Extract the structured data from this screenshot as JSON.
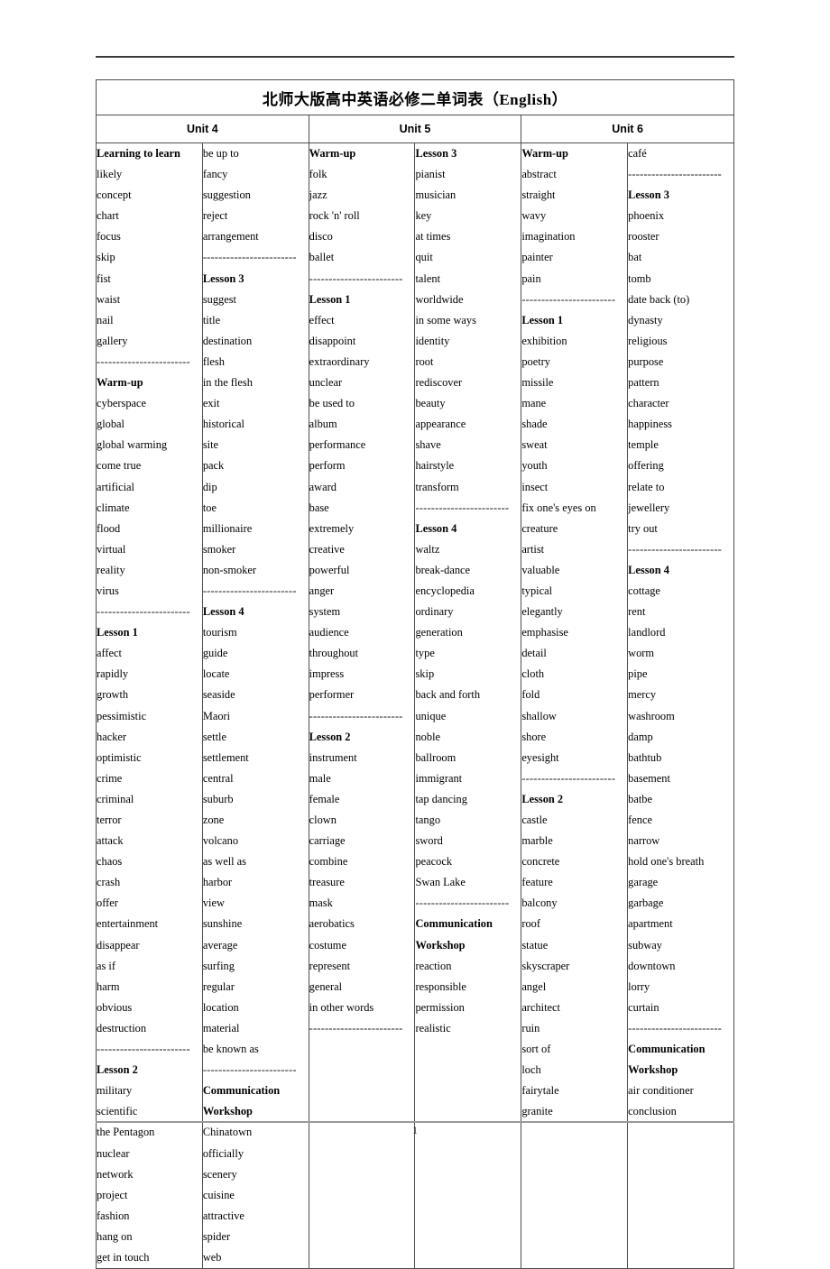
{
  "document": {
    "title": "北师大版高中英语必修二单词表（English）",
    "page_number": "1"
  },
  "units": [
    {
      "label": "Unit 4"
    },
    {
      "label": "Unit 5"
    },
    {
      "label": "Unit 6"
    }
  ],
  "separator": "------------------------",
  "columns": [
    {
      "id": "unit4-col1",
      "items": [
        {
          "text": "Learning to learn",
          "bold": true
        },
        {
          "text": "likely"
        },
        {
          "text": "concept"
        },
        {
          "text": "chart"
        },
        {
          "text": "focus"
        },
        {
          "text": "skip"
        },
        {
          "text": "fist"
        },
        {
          "text": "waist"
        },
        {
          "text": "nail"
        },
        {
          "text": "gallery"
        },
        {
          "text": "------------------------",
          "sep": true
        },
        {
          "text": "Warm-up",
          "bold": true
        },
        {
          "text": "cyberspace"
        },
        {
          "text": "global"
        },
        {
          "text": "global warming"
        },
        {
          "text": "come true"
        },
        {
          "text": "artificial"
        },
        {
          "text": "climate"
        },
        {
          "text": "flood"
        },
        {
          "text": "virtual"
        },
        {
          "text": "reality"
        },
        {
          "text": "virus"
        },
        {
          "text": "------------------------",
          "sep": true
        },
        {
          "text": "Lesson 1",
          "bold": true
        },
        {
          "text": "affect"
        },
        {
          "text": "rapidly"
        },
        {
          "text": "growth"
        },
        {
          "text": "pessimistic"
        },
        {
          "text": "hacker"
        },
        {
          "text": "optimistic"
        },
        {
          "text": "crime"
        },
        {
          "text": "criminal"
        },
        {
          "text": "terror"
        },
        {
          "text": "attack"
        },
        {
          "text": "chaos"
        },
        {
          "text": "crash"
        },
        {
          "text": "offer"
        },
        {
          "text": "entertainment"
        },
        {
          "text": "disappear"
        },
        {
          "text": "as if"
        },
        {
          "text": "harm"
        },
        {
          "text": "obvious"
        },
        {
          "text": "destruction"
        },
        {
          "text": "------------------------",
          "sep": true
        },
        {
          "text": "Lesson 2",
          "bold": true
        },
        {
          "text": "military"
        },
        {
          "text": "scientific"
        },
        {
          "text": "the Pentagon"
        },
        {
          "text": "nuclear"
        },
        {
          "text": "network"
        },
        {
          "text": "project"
        },
        {
          "text": "fashion"
        },
        {
          "text": "hang on"
        },
        {
          "text": "get in touch"
        }
      ]
    },
    {
      "id": "unit4-col2",
      "items": [
        {
          "text": "be up to"
        },
        {
          "text": "fancy"
        },
        {
          "text": "suggestion"
        },
        {
          "text": "reject"
        },
        {
          "text": "arrangement"
        },
        {
          "text": "------------------------",
          "sep": true
        },
        {
          "text": "Lesson 3",
          "bold": true
        },
        {
          "text": "suggest"
        },
        {
          "text": "title"
        },
        {
          "text": "destination"
        },
        {
          "text": "flesh"
        },
        {
          "text": "in the flesh"
        },
        {
          "text": "exit"
        },
        {
          "text": "historical"
        },
        {
          "text": "site"
        },
        {
          "text": "pack"
        },
        {
          "text": "dip"
        },
        {
          "text": "toe"
        },
        {
          "text": "millionaire"
        },
        {
          "text": "smoker"
        },
        {
          "text": "non-smoker"
        },
        {
          "text": "------------------------",
          "sep": true
        },
        {
          "text": "Lesson 4",
          "bold": true
        },
        {
          "text": "tourism"
        },
        {
          "text": "guide"
        },
        {
          "text": "locate"
        },
        {
          "text": "seaside"
        },
        {
          "text": "Maori"
        },
        {
          "text": "settle"
        },
        {
          "text": "settlement"
        },
        {
          "text": "central"
        },
        {
          "text": "suburb"
        },
        {
          "text": "zone"
        },
        {
          "text": "volcano"
        },
        {
          "text": "as well as"
        },
        {
          "text": "harbor"
        },
        {
          "text": "view"
        },
        {
          "text": "sunshine"
        },
        {
          "text": "average"
        },
        {
          "text": "surfing"
        },
        {
          "text": "regular"
        },
        {
          "text": "location"
        },
        {
          "text": "material"
        },
        {
          "text": "be known as"
        },
        {
          "text": "------------------------",
          "sep": true
        },
        {
          "text": "Communication",
          "bold": true
        },
        {
          "text": "Workshop",
          "bold": true
        },
        {
          "text": "Chinatown"
        },
        {
          "text": "officially"
        },
        {
          "text": "scenery"
        },
        {
          "text": "cuisine"
        },
        {
          "text": "attractive"
        },
        {
          "text": "spider"
        },
        {
          "text": "web"
        }
      ]
    },
    {
      "id": "unit5-col1",
      "items": [
        {
          "text": "Warm-up",
          "bold": true
        },
        {
          "text": "folk"
        },
        {
          "text": "jazz"
        },
        {
          "text": "rock 'n' roll"
        },
        {
          "text": "disco"
        },
        {
          "text": "ballet"
        },
        {
          "text": "------------------------",
          "sep": true
        },
        {
          "text": "Lesson 1",
          "bold": true
        },
        {
          "text": "effect"
        },
        {
          "text": "disappoint"
        },
        {
          "text": "extraordinary"
        },
        {
          "text": "unclear"
        },
        {
          "text": "be used to"
        },
        {
          "text": "album"
        },
        {
          "text": "performance"
        },
        {
          "text": "perform"
        },
        {
          "text": "award"
        },
        {
          "text": "base"
        },
        {
          "text": "extremely"
        },
        {
          "text": "creative"
        },
        {
          "text": "powerful"
        },
        {
          "text": "anger"
        },
        {
          "text": "system"
        },
        {
          "text": "audience"
        },
        {
          "text": "throughout"
        },
        {
          "text": "impress"
        },
        {
          "text": "performer"
        },
        {
          "text": "------------------------",
          "sep": true
        },
        {
          "text": "Lesson 2",
          "bold": true
        },
        {
          "text": "instrument"
        },
        {
          "text": "male"
        },
        {
          "text": "female"
        },
        {
          "text": "clown"
        },
        {
          "text": "carriage"
        },
        {
          "text": "combine"
        },
        {
          "text": "treasure"
        },
        {
          "text": "mask"
        },
        {
          "text": "aerobatics"
        },
        {
          "text": "costume"
        },
        {
          "text": "represent"
        },
        {
          "text": "general"
        },
        {
          "text": "in other words"
        },
        {
          "text": "------------------------",
          "sep": true
        }
      ]
    },
    {
      "id": "unit5-col2",
      "items": [
        {
          "text": "Lesson 3",
          "bold": true
        },
        {
          "text": "pianist"
        },
        {
          "text": "musician"
        },
        {
          "text": "key"
        },
        {
          "text": "at times"
        },
        {
          "text": "quit"
        },
        {
          "text": "talent"
        },
        {
          "text": "worldwide"
        },
        {
          "text": "in some ways"
        },
        {
          "text": "identity"
        },
        {
          "text": "root"
        },
        {
          "text": "rediscover"
        },
        {
          "text": "beauty"
        },
        {
          "text": "appearance"
        },
        {
          "text": "shave"
        },
        {
          "text": "hairstyle"
        },
        {
          "text": "transform"
        },
        {
          "text": "------------------------",
          "sep": true
        },
        {
          "text": "Lesson 4",
          "bold": true
        },
        {
          "text": "waltz"
        },
        {
          "text": "break-dance"
        },
        {
          "text": "encyclopedia"
        },
        {
          "text": "ordinary"
        },
        {
          "text": "generation"
        },
        {
          "text": "type"
        },
        {
          "text": "skip"
        },
        {
          "text": "back and forth"
        },
        {
          "text": "unique"
        },
        {
          "text": "noble"
        },
        {
          "text": "ballroom"
        },
        {
          "text": "immigrant"
        },
        {
          "text": "tap dancing"
        },
        {
          "text": "tango"
        },
        {
          "text": "sword"
        },
        {
          "text": "peacock"
        },
        {
          "text": "Swan Lake"
        },
        {
          "text": "------------------------",
          "sep": true
        },
        {
          "text": "Communication",
          "bold": true
        },
        {
          "text": "Workshop",
          "bold": true
        },
        {
          "text": "reaction"
        },
        {
          "text": "responsible"
        },
        {
          "text": "permission"
        },
        {
          "text": "realistic"
        }
      ]
    },
    {
      "id": "unit6-col1",
      "items": [
        {
          "text": "Warm-up",
          "bold": true
        },
        {
          "text": "abstract"
        },
        {
          "text": "straight"
        },
        {
          "text": "wavy"
        },
        {
          "text": "imagination"
        },
        {
          "text": "painter"
        },
        {
          "text": "pain"
        },
        {
          "text": "------------------------",
          "sep": true
        },
        {
          "text": "Lesson 1",
          "bold": true
        },
        {
          "text": "exhibition"
        },
        {
          "text": "poetry"
        },
        {
          "text": "missile"
        },
        {
          "text": "mane"
        },
        {
          "text": "shade"
        },
        {
          "text": "sweat"
        },
        {
          "text": "youth"
        },
        {
          "text": "insect"
        },
        {
          "text": "fix one's eyes on"
        },
        {
          "text": "creature"
        },
        {
          "text": "artist"
        },
        {
          "text": "valuable"
        },
        {
          "text": "typical"
        },
        {
          "text": "elegantly"
        },
        {
          "text": "emphasise"
        },
        {
          "text": "detail"
        },
        {
          "text": "cloth"
        },
        {
          "text": "fold"
        },
        {
          "text": "shallow"
        },
        {
          "text": "shore"
        },
        {
          "text": "eyesight"
        },
        {
          "text": "------------------------",
          "sep": true
        },
        {
          "text": "Lesson 2",
          "bold": true
        },
        {
          "text": "castle"
        },
        {
          "text": "marble"
        },
        {
          "text": "concrete"
        },
        {
          "text": "feature"
        },
        {
          "text": "balcony"
        },
        {
          "text": "roof"
        },
        {
          "text": "statue"
        },
        {
          "text": "skyscraper"
        },
        {
          "text": "angel"
        },
        {
          "text": "architect"
        },
        {
          "text": "ruin"
        },
        {
          "text": "sort of"
        },
        {
          "text": "loch"
        },
        {
          "text": "fairytale"
        },
        {
          "text": "granite"
        }
      ]
    },
    {
      "id": "unit6-col2",
      "items": [
        {
          "text": "café"
        },
        {
          "text": "------------------------",
          "sep": true
        },
        {
          "text": "Lesson 3",
          "bold": true
        },
        {
          "text": "phoenix"
        },
        {
          "text": "rooster"
        },
        {
          "text": "bat"
        },
        {
          "text": "tomb"
        },
        {
          "text": "date back (to)"
        },
        {
          "text": "dynasty"
        },
        {
          "text": "religious"
        },
        {
          "text": "purpose"
        },
        {
          "text": "pattern"
        },
        {
          "text": "character"
        },
        {
          "text": "happiness"
        },
        {
          "text": "temple"
        },
        {
          "text": "offering"
        },
        {
          "text": "relate to"
        },
        {
          "text": "jewellery"
        },
        {
          "text": "try out"
        },
        {
          "text": "------------------------",
          "sep": true
        },
        {
          "text": "Lesson 4",
          "bold": true
        },
        {
          "text": "cottage"
        },
        {
          "text": "rent"
        },
        {
          "text": "landlord"
        },
        {
          "text": "worm"
        },
        {
          "text": "pipe"
        },
        {
          "text": "mercy"
        },
        {
          "text": "washroom"
        },
        {
          "text": "damp"
        },
        {
          "text": "bathtub"
        },
        {
          "text": "basement"
        },
        {
          "text": "batbe"
        },
        {
          "text": "fence"
        },
        {
          "text": "narrow"
        },
        {
          "text": "hold one's breath"
        },
        {
          "text": "garage"
        },
        {
          "text": "garbage"
        },
        {
          "text": "apartment"
        },
        {
          "text": "subway"
        },
        {
          "text": "downtown"
        },
        {
          "text": "lorry"
        },
        {
          "text": "curtain"
        },
        {
          "text": "------------------------",
          "sep": true
        },
        {
          "text": "Communication",
          "bold": true
        },
        {
          "text": "Workshop",
          "bold": true
        },
        {
          "text": "air conditioner"
        },
        {
          "text": "conclusion"
        }
      ]
    }
  ]
}
